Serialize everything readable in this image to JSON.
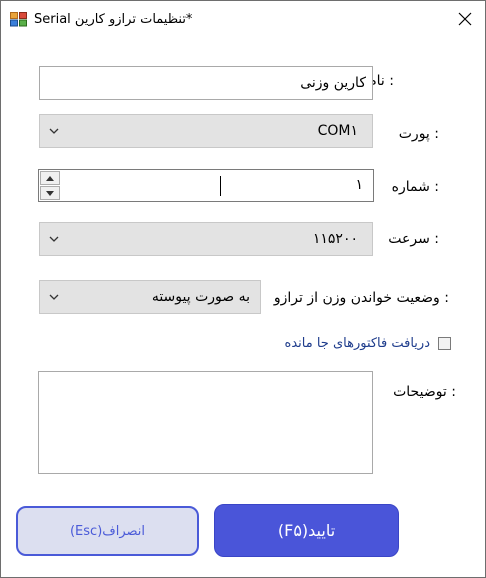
{
  "window": {
    "title": "*تنظیمات ترازو کارین Serial",
    "close_icon": "close-icon",
    "app_icon": "window-app-icon"
  },
  "form": {
    "name": {
      "label": ": نام",
      "value": "کارین وزنی"
    },
    "port": {
      "label": ": پورت",
      "value": "COM۱"
    },
    "number": {
      "label": ": شماره",
      "value": "۱"
    },
    "speed": {
      "label": ": سرعت",
      "value": "۱۱۵۲۰۰"
    },
    "read_mode": {
      "label": ": وضعیت خواندن وزن از ترازو",
      "value": "به صورت پیوسته"
    },
    "missed_invoices": {
      "label": "دریافت فاکتورهای جا مانده",
      "checked": false
    },
    "notes": {
      "label": ": توضیحات",
      "value": ""
    }
  },
  "buttons": {
    "cancel_label": "انصراف(Esc)",
    "ok_label": "تایید(F۵)"
  },
  "colors": {
    "accent": "#4a55d9",
    "combo_bg": "#e3e3e3",
    "checkbox_label": "#1e3c8c"
  }
}
